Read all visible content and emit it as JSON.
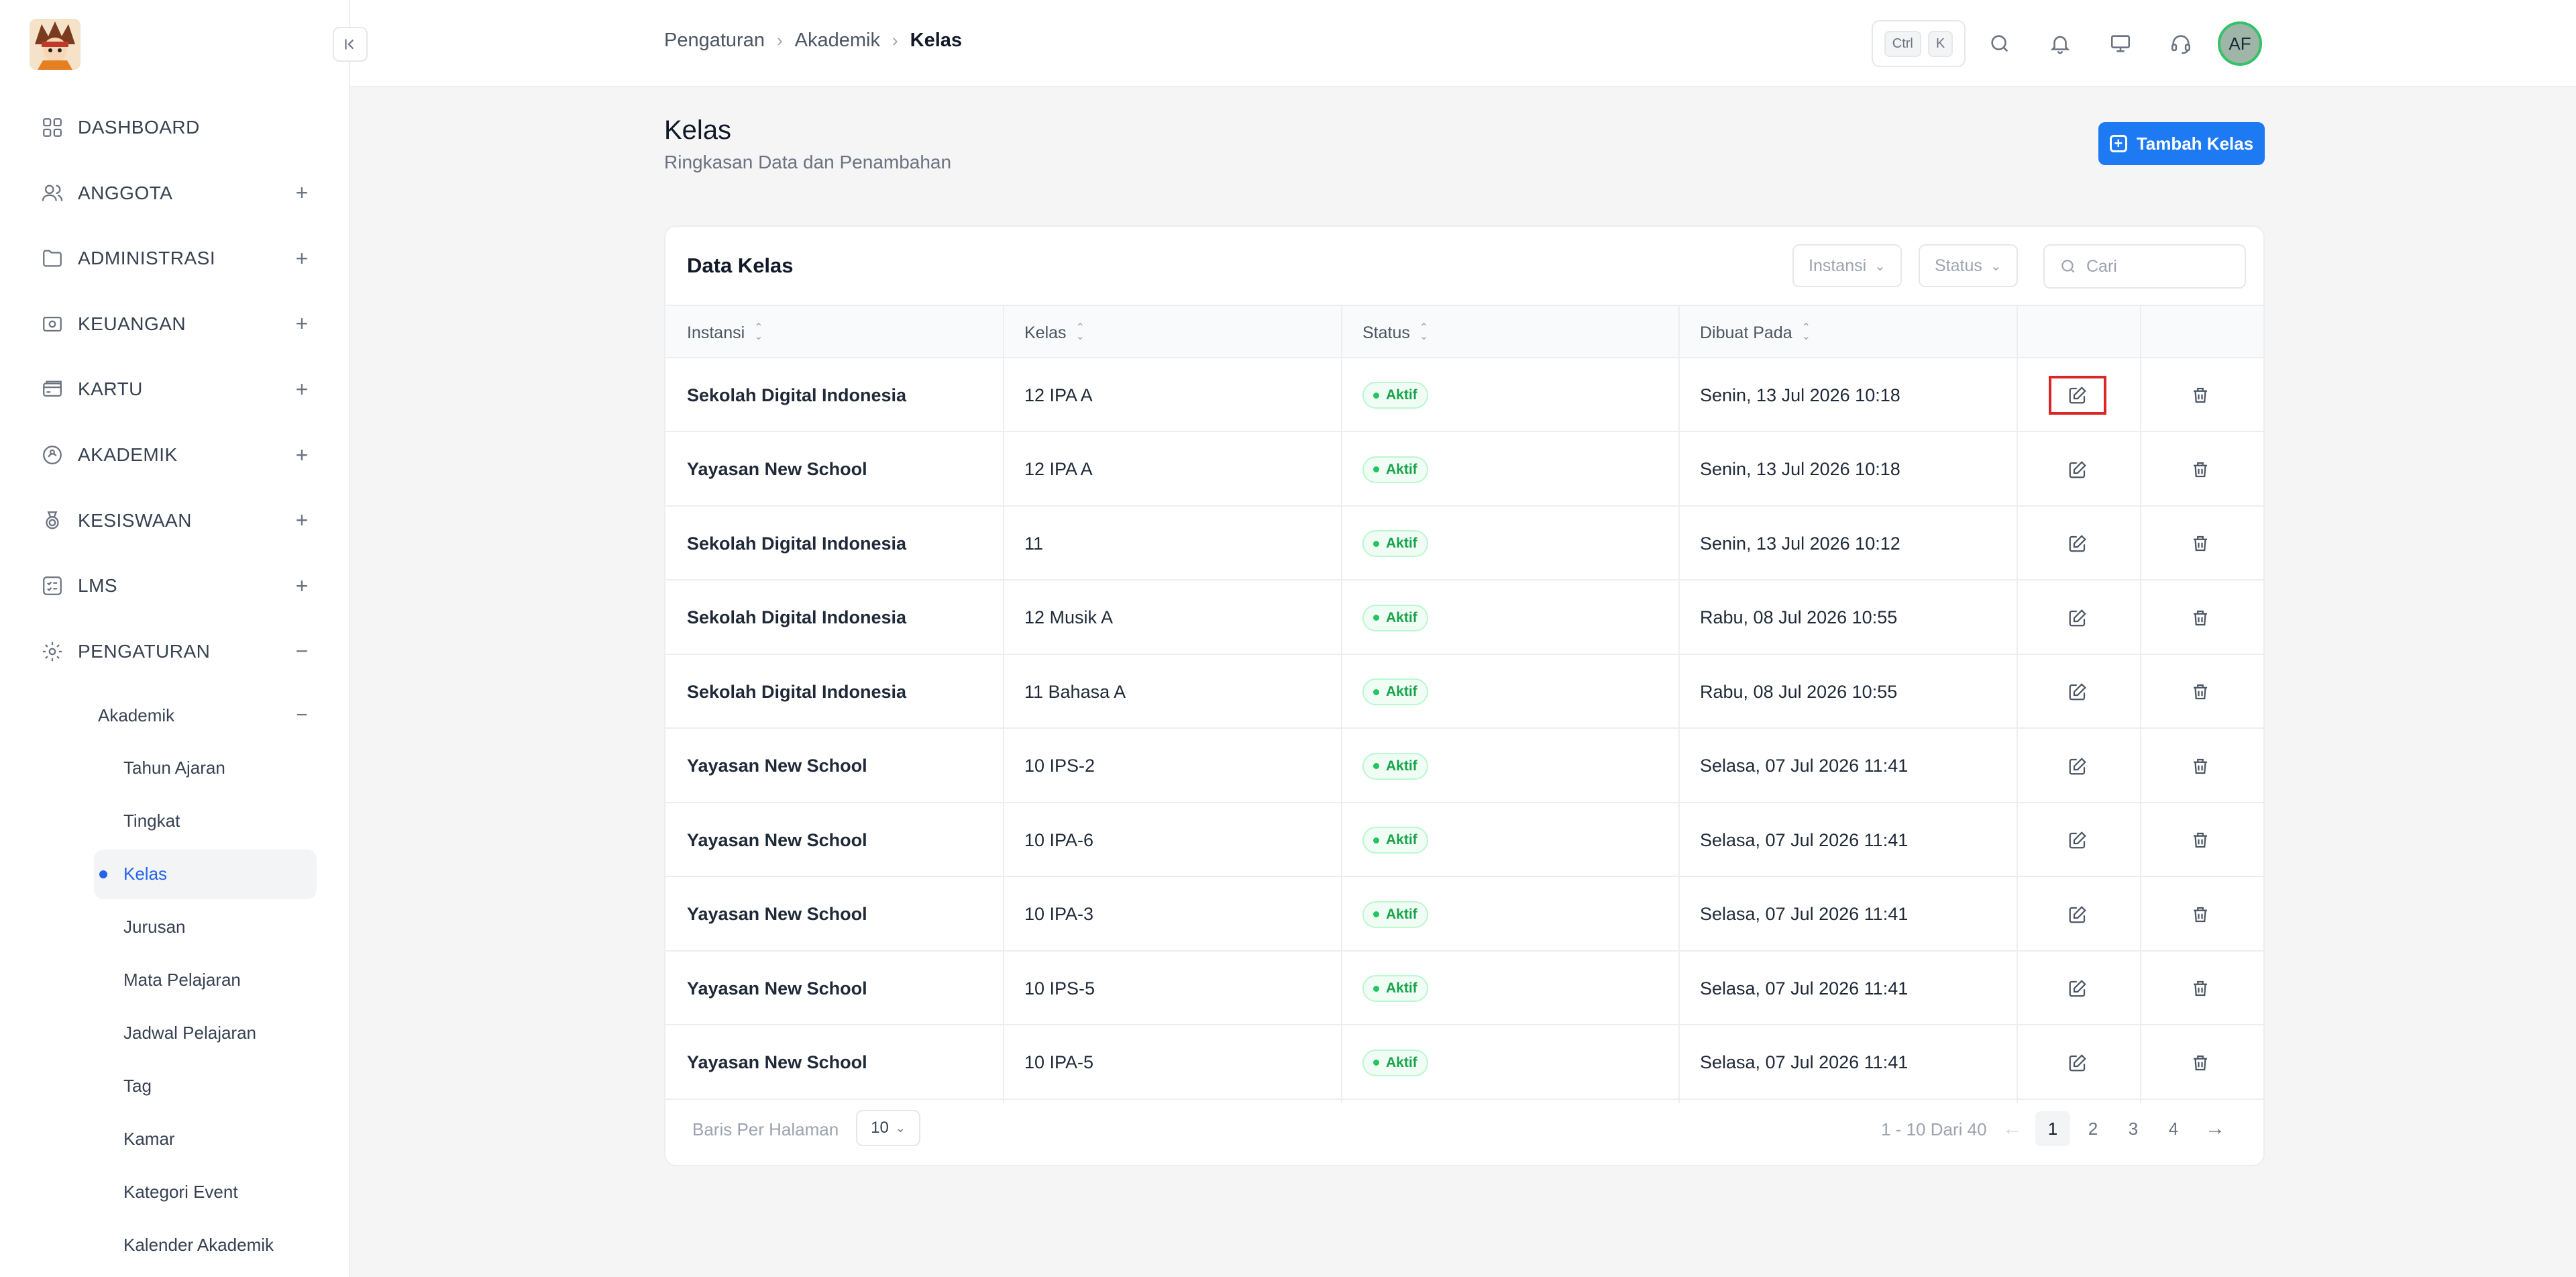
{
  "sidebar": {
    "nav": [
      {
        "label": "DASHBOARD",
        "icon": "grid-icon",
        "expand": ""
      },
      {
        "label": "ANGGOTA",
        "icon": "users-icon",
        "expand": "+"
      },
      {
        "label": "ADMINISTRASI",
        "icon": "folder-icon",
        "expand": "+"
      },
      {
        "label": "KEUANGAN",
        "icon": "cash-icon",
        "expand": "+"
      },
      {
        "label": "KARTU",
        "icon": "card-icon",
        "expand": "+"
      },
      {
        "label": "AKADEMIK",
        "icon": "academic-icon",
        "expand": "+"
      },
      {
        "label": "KESISWAAN",
        "icon": "medal-icon",
        "expand": "+"
      },
      {
        "label": "LMS",
        "icon": "list-icon",
        "expand": "+"
      },
      {
        "label": "PENGATURAN",
        "icon": "gear-icon",
        "expand": "−"
      }
    ],
    "group": {
      "label": "Akademik",
      "expand": "−"
    },
    "sub_items": [
      "Tahun Ajaran",
      "Tingkat",
      "Kelas",
      "Jurusan",
      "Mata Pelajaran",
      "Jadwal Pelajaran",
      "Tag",
      "Kamar",
      "Kategori Event",
      "Kalender Akademik"
    ],
    "active_item": "Kelas"
  },
  "topbar": {
    "breadcrumb": [
      "Pengaturan",
      "Akademik",
      "Kelas"
    ],
    "shortcut": [
      "Ctrl",
      "K"
    ],
    "icons": [
      "search-icon",
      "bell-icon",
      "monitor-icon",
      "headset-icon"
    ],
    "avatar_initials": "AF"
  },
  "page": {
    "title": "Kelas",
    "subtitle": "Ringkasan Data dan Penambahan",
    "add_button": "Tambah Kelas"
  },
  "table": {
    "title": "Data Kelas",
    "filters": [
      "Instansi",
      "Status"
    ],
    "search_placeholder": "Cari",
    "columns": [
      "Instansi",
      "Kelas",
      "Status",
      "Dibuat Pada"
    ],
    "rows": [
      {
        "instansi": "Sekolah Digital Indonesia",
        "kelas": "12 IPA A",
        "status": "Aktif",
        "dibuat": "Senin, 13 Jul 2026 10:18"
      },
      {
        "instansi": "Yayasan New School",
        "kelas": "12 IPA A",
        "status": "Aktif",
        "dibuat": "Senin, 13 Jul 2026 10:18"
      },
      {
        "instansi": "Sekolah Digital Indonesia",
        "kelas": "11",
        "status": "Aktif",
        "dibuat": "Senin, 13 Jul 2026 10:12"
      },
      {
        "instansi": "Sekolah Digital Indonesia",
        "kelas": "12 Musik A",
        "status": "Aktif",
        "dibuat": "Rabu, 08 Jul 2026 10:55"
      },
      {
        "instansi": "Sekolah Digital Indonesia",
        "kelas": "11 Bahasa A",
        "status": "Aktif",
        "dibuat": "Rabu, 08 Jul 2026 10:55"
      },
      {
        "instansi": "Yayasan New School",
        "kelas": "10 IPS-2",
        "status": "Aktif",
        "dibuat": "Selasa, 07 Jul 2026 11:41"
      },
      {
        "instansi": "Yayasan New School",
        "kelas": "10 IPA-6",
        "status": "Aktif",
        "dibuat": "Selasa, 07 Jul 2026 11:41"
      },
      {
        "instansi": "Yayasan New School",
        "kelas": "10 IPA-3",
        "status": "Aktif",
        "dibuat": "Selasa, 07 Jul 2026 11:41"
      },
      {
        "instansi": "Yayasan New School",
        "kelas": "10 IPS-5",
        "status": "Aktif",
        "dibuat": "Selasa, 07 Jul 2026 11:41"
      },
      {
        "instansi": "Yayasan New School",
        "kelas": "10 IPA-5",
        "status": "Aktif",
        "dibuat": "Selasa, 07 Jul 2026 11:41"
      }
    ],
    "highlighted_row": 0
  },
  "pagination": {
    "rows_per_page_label": "Baris Per Halaman",
    "rows_per_page": "10",
    "range": "1 - 10 Dari 40",
    "pages": [
      "1",
      "2",
      "3",
      "4"
    ],
    "current_page": "1",
    "prev": "←",
    "next": "→"
  },
  "colors": {
    "accent": "#1d7af3",
    "active_green": "#16a34a",
    "highlight": "#dc2626"
  }
}
